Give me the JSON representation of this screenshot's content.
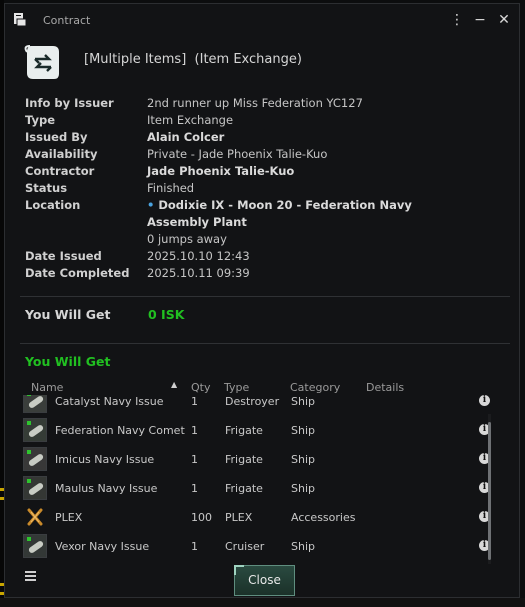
{
  "window": {
    "title": "Contract"
  },
  "header": {
    "title": "[Multiple Items]  (Item Exchange)"
  },
  "info": [
    {
      "label": "Info by Issuer",
      "value": "2nd runner up Miss Federation YC127",
      "bold": false
    },
    {
      "label": "Type",
      "value": "Item Exchange",
      "bold": false
    },
    {
      "label": "Issued By",
      "value": "Alain Colcer",
      "bold": true
    },
    {
      "label": "Availability",
      "value": "Private - Jade Phoenix Talie-Kuo",
      "bold": false
    },
    {
      "label": "Contractor",
      "value": "Jade Phoenix Talie-Kuo",
      "bold": true
    },
    {
      "label": "Status",
      "value": "Finished",
      "bold": false
    },
    {
      "label": "Location",
      "value": "Dodixie IX - Moon 20 - Federation Navy Assembly Plant",
      "bold": true,
      "subvalue": "0 jumps away"
    },
    {
      "label": "Date Issued",
      "value": "2025.10.10 12:43",
      "bold": false
    },
    {
      "label": "Date Completed",
      "value": "2025.10.11 09:39",
      "bold": false
    }
  ],
  "get_isk": {
    "label": "You Will Get",
    "value": "0 ISK"
  },
  "items_section": {
    "label": "You Will Get"
  },
  "columns": [
    "Name",
    "Qty",
    "Type",
    "Category",
    "Details"
  ],
  "items": [
    {
      "name": "Catalyst Navy Issue",
      "qty": "1",
      "type": "Destroyer",
      "category": "Ship",
      "icon": "ship-icon"
    },
    {
      "name": "Federation Navy Comet",
      "qty": "1",
      "type": "Frigate",
      "category": "Ship",
      "icon": "ship-icon"
    },
    {
      "name": "Imicus Navy Issue",
      "qty": "1",
      "type": "Frigate",
      "category": "Ship",
      "icon": "ship-icon"
    },
    {
      "name": "Maulus Navy Issue",
      "qty": "1",
      "type": "Frigate",
      "category": "Ship",
      "icon": "ship-icon"
    },
    {
      "name": "PLEX",
      "qty": "100",
      "type": "PLEX",
      "category": "Accessories",
      "icon": "plex-icon"
    },
    {
      "name": "Vexor Navy Issue",
      "qty": "1",
      "type": "Cruiser",
      "category": "Ship",
      "icon": "ship-icon"
    }
  ],
  "footer": {
    "close_label": "Close"
  },
  "colors": {
    "accent_green": "#21c021",
    "location_dot": "#4aa3df",
    "button_border": "#5f8e7f"
  }
}
